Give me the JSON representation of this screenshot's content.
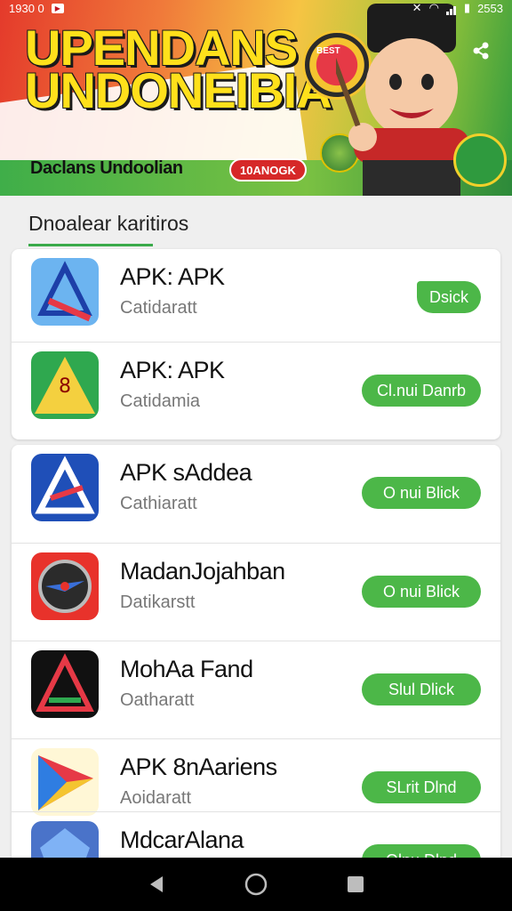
{
  "status_bar": {
    "time": "1930 0",
    "right_text": "2553"
  },
  "banner": {
    "title_line1": "UPENDANS",
    "title_line2": "UNDONEIBIA",
    "subtitle": "Daclans Undoolian",
    "tag": "10ANOGK",
    "medal_text": "BEST"
  },
  "section": {
    "title": "Dnoalear karitiros"
  },
  "apps": [
    {
      "name": "APK: APK",
      "category": "Catidaratt",
      "button": "Dsick",
      "icon": "triangle-a-icon"
    },
    {
      "name": "APK: APK",
      "category": "Catidamia",
      "button": "Cl.nui Danrb",
      "icon": "green-yellow-triangle-icon"
    },
    {
      "name": "APK sAddea",
      "category": "Cathiaratt",
      "button": "O nui Blick",
      "icon": "blue-a-icon"
    },
    {
      "name": "MadanJojahban",
      "category": "Datikarstt",
      "button": "O nui Blick",
      "icon": "red-compass-icon"
    },
    {
      "name": "MohAa Fand",
      "category": "Oatharatt",
      "button": "Slul Dlick",
      "icon": "dark-triangle-icon"
    },
    {
      "name": "APK 8nAariens",
      "category": "Aoidaratt",
      "button": "SLrit Dlnd",
      "icon": "play-triangle-icon"
    },
    {
      "name": "MdcarAlana",
      "category": "",
      "button": "Olnu Dlnd",
      "icon": "blue-gem-icon"
    }
  ],
  "colors": {
    "accent": "#4cb748",
    "banner_red": "#e43a2b",
    "banner_yellow": "#ffe01b"
  }
}
